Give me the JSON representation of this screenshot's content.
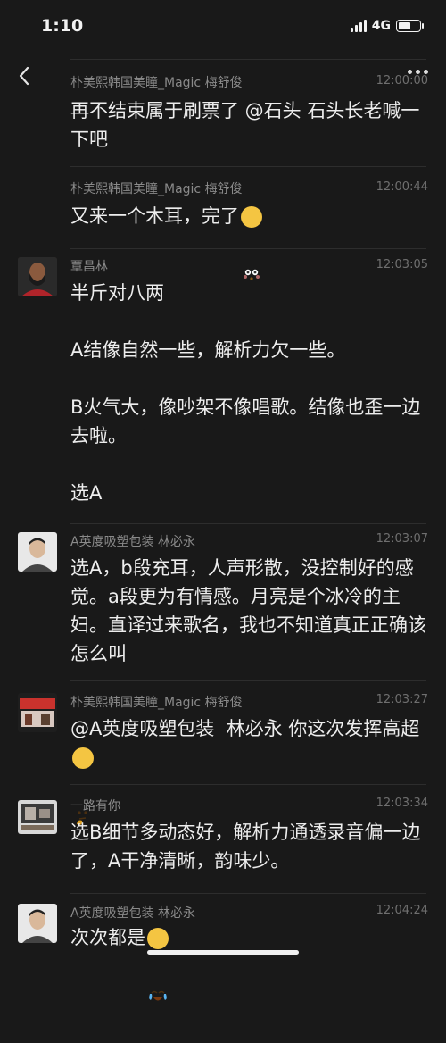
{
  "status_bar": {
    "time": "1:10",
    "network": "4G"
  },
  "messages": [
    {
      "sender": "朴美熙韩国美瞳_Magic 梅舒俊",
      "time": "12:00:00",
      "text": "再不结束属于刷票了 @石头 石头长老喊一下吧"
    },
    {
      "sender": "朴美熙韩国美瞳_Magic 梅舒俊",
      "time": "12:00:44",
      "text": "又来一个木耳，完了",
      "emoji": "flushed-face"
    },
    {
      "sender": "覃昌林",
      "time": "12:03:05",
      "text": "半斤对八两\n\nA结像自然一些，解析力欠一些。\n\nB火气大，像吵架不像唱歌。结像也歪一边去啦。\n\n选A"
    },
    {
      "sender": "A英度吸塑包装  林必永",
      "time": "12:03:07",
      "text": "选A，b段充耳，人声形散，没控制好的感觉。a段更为有情感。月亮是个冰冷的主妇。直译过来歌名，我也不知道真正正确该怎么叫"
    },
    {
      "sender": "朴美熙韩国美瞳_Magic 梅舒俊",
      "time": "12:03:27",
      "text": "@A英度吸塑包装  林必永 你这次发挥高超",
      "emoji": "thinking-face"
    },
    {
      "sender": "一路有你",
      "time": "12:03:34",
      "text": "选B细节多动态好，解析力通透录音偏一边了，A干净清晰，韵味少。"
    },
    {
      "sender": "A英度吸塑包装  林必永",
      "time": "12:04:24",
      "text": "次次都是",
      "emoji": "crying-face"
    }
  ]
}
